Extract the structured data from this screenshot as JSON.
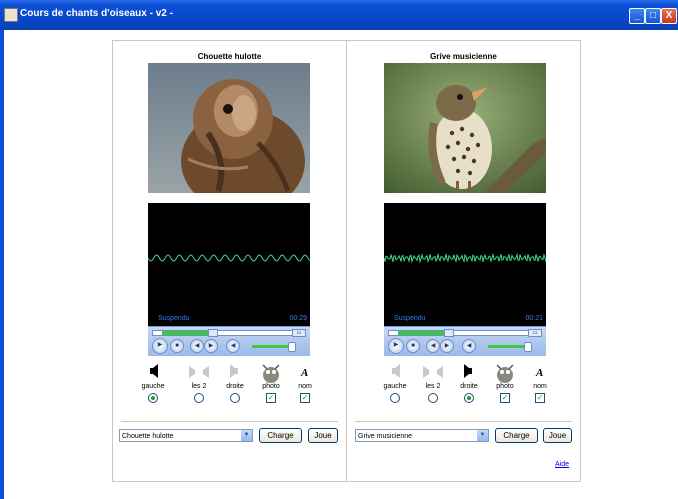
{
  "window": {
    "title": "Cours de chants d'oiseaux - v2 -",
    "min_label": "_",
    "max_label": "□",
    "close_label": "X"
  },
  "players": [
    {
      "bird_name": "Chouette hulotte",
      "media_status": "Suspendu",
      "media_time": "00:29",
      "seek_fraction": 0.32,
      "channels": {
        "gauche": "gauche",
        "les2": "les 2",
        "droite": "droite",
        "photo": "photo",
        "nom": "nom",
        "selected": "gauche",
        "photo_checked": true,
        "nom_checked": true
      },
      "select_value": "Chouette hulotte",
      "charge_label": "Charge",
      "joue_label": "Joue"
    },
    {
      "bird_name": "Grive musicienne",
      "media_status": "Suspendu",
      "media_time": "00:21",
      "seek_fraction": 0.32,
      "channels": {
        "gauche": "gauche",
        "les2": "les 2",
        "droite": "droite",
        "photo": "photo",
        "nom": "nom",
        "selected": "droite",
        "photo_checked": true,
        "nom_checked": true
      },
      "select_value": "Grive musicienne",
      "charge_label": "Charge",
      "joue_label": "Joue"
    }
  ],
  "help_link": "Aide",
  "colors": {
    "waveform": "#3fd98a",
    "titlebar": "#0a4fd6",
    "player_text": "#3a7cf0"
  }
}
